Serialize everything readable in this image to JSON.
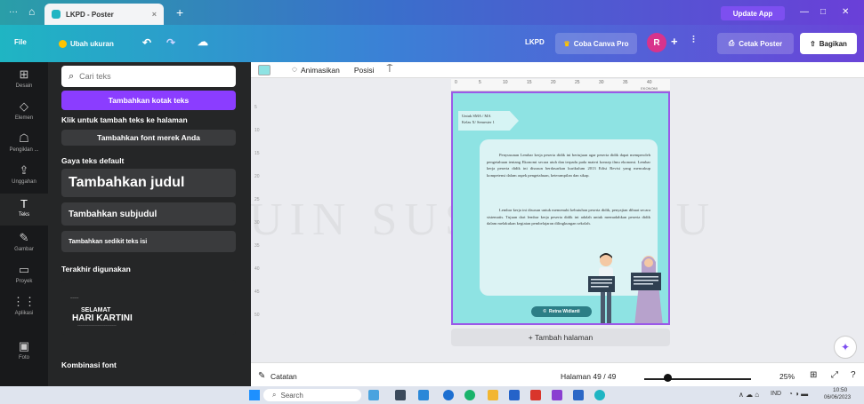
{
  "browser": {
    "menu_dots": "···",
    "tab_title": "LKPD - Poster",
    "tab_close": "×",
    "new_tab": "+",
    "update_label": "Update App",
    "min": "—",
    "max": "□",
    "close": "✕"
  },
  "menubar": {
    "file": "File",
    "resize": "Ubah ukuran",
    "doc_title": "LKPD",
    "try_pro": "Coba Canva Pro",
    "avatar_initial": "R",
    "print": "Cetak Poster",
    "share": "Bagikan"
  },
  "leftnav": [
    {
      "label": "Desain",
      "icon": "⊞"
    },
    {
      "label": "Elemen",
      "icon": "◇"
    },
    {
      "label": "Pengiklan ...",
      "icon": "☖"
    },
    {
      "label": "Unggahan",
      "icon": "⇪"
    },
    {
      "label": "Teks",
      "icon": "T"
    },
    {
      "label": "Gambar",
      "icon": "✎"
    },
    {
      "label": "Proyek",
      "icon": "▭"
    },
    {
      "label": "Aplikasi",
      "icon": "⋮⋮"
    },
    {
      "label": "Foto",
      "icon": "▣"
    }
  ],
  "panel": {
    "search_placeholder": "Cari teks",
    "add_textbox": "Tambahkan kotak teks",
    "click_hint": "Klik untuk tambah teks ke halaman",
    "add_brand_font": "Tambahkan font merek Anda",
    "default_styles": "Gaya teks default",
    "add_heading": "Tambahkan judul",
    "add_subheading": "Tambahkan subjudul",
    "add_body": "Tambahkan sedikit teks isi",
    "recent": "Terakhir digunakan",
    "recent_small": "~~~~",
    "recent_line1": "SELAMAT",
    "recent_line2": "HARI KARTINI",
    "recent_line3": "~~~~~~~~~~~~~~~~~~~~~~~~~",
    "combos": "Kombinasi font"
  },
  "toolbar": {
    "animate": "Animasikan",
    "position": "Posisi"
  },
  "ruler": [
    "0",
    "5",
    "10",
    "15",
    "20",
    "25",
    "30",
    "35",
    "40"
  ],
  "ruler_note": "EKONOMI",
  "vruler": [
    "5",
    "10",
    "15",
    "20",
    "25",
    "30",
    "35",
    "40",
    "45",
    "50"
  ],
  "page": {
    "tag_line1": "Untuk SMA / MA",
    "tag_line2": "Kelas X/ Semester 1",
    "para1": "Penyusunan Lembar kerja peserta didik ini bertujuan agar peserta didik dapat memperoleh pengetahuan tentang Ekonomi secara utuh dan terpadu pada materi konsep ilmu ekonomi. Lembar kerja peserta didik ini disusun berdasarkan kurikulum 2013 Edisi Revisi yang mencakup kompetensi dalam aspek pengetahuan, keterampilan dan sikap.",
    "para2": "Lembar kerja ini disusun untuk memenuhi kebutuhan peserta didik, penyajian dibuat secara sistematis. Tujuan dari lembar kerja peserta didik ini adalah untuk memudahkan peserta didik dalam melakukan kegiatan pembelajaran dilingkungan sekolah.",
    "author": "Retna Widianti"
  },
  "add_page": "+ Tambah halaman",
  "status": {
    "notes": "Catatan",
    "page_info": "Halaman 49 / 49",
    "zoom": "25%",
    "zoom_fraction": 0.25
  },
  "taskbar": {
    "search": "Search",
    "lang": "IND",
    "time": "10:50",
    "date": "06/06/2023"
  },
  "watermark": "UIN SUSKA RIAU"
}
